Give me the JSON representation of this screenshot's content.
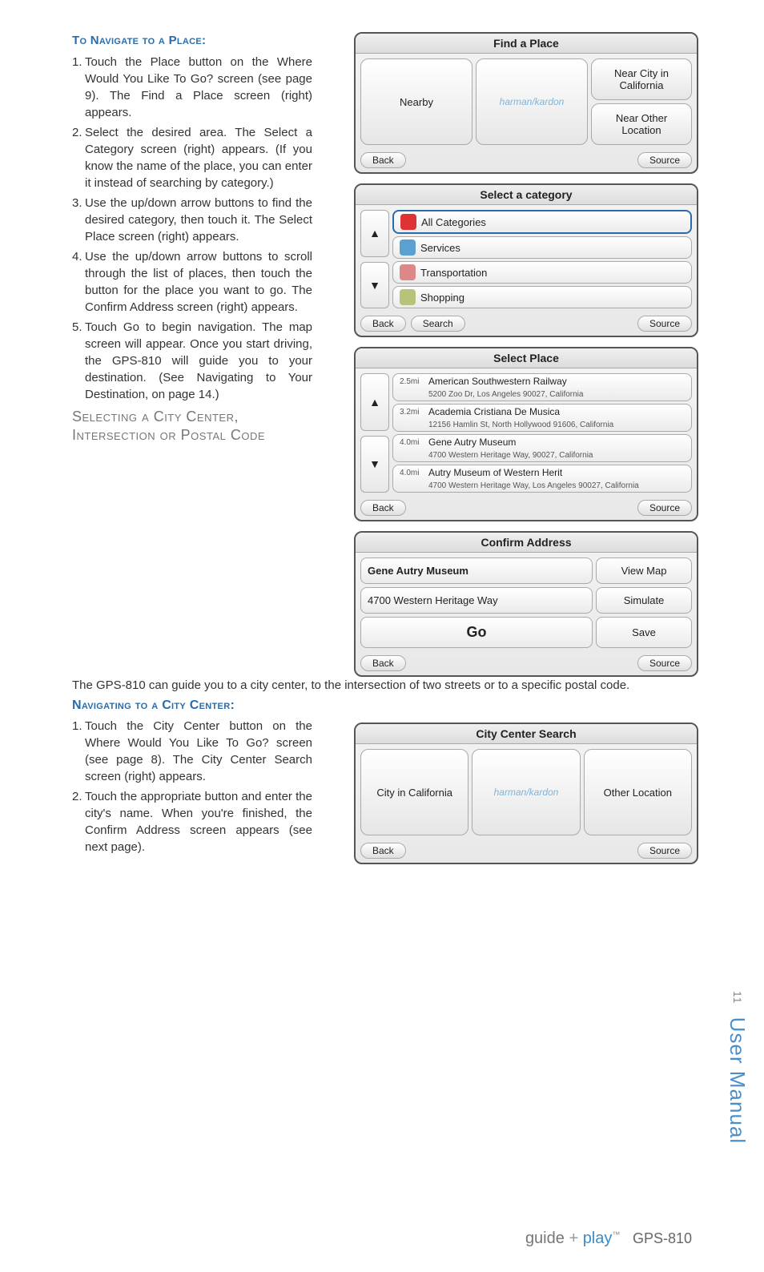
{
  "heading_navigate": "To Navigate to a Place:",
  "steps_navigate": [
    "Touch the Place button on the Where Would You Like To Go? screen (see page 9). The Find a Place screen (right) appears.",
    "Select the desired area. The Select a Category screen (right) appears. (If you know the name of the place, you can enter it instead of searching by category.)",
    "Use the up/down arrow buttons to find the desired category, then touch it. The Select Place screen (right) appears.",
    "Use the up/down arrow buttons to scroll through the list of places, then touch the button for the place you want to go. The Confirm Address screen (right) appears.",
    "Touch Go to begin navigation. The map screen will appear. Once you start driving, the GPS-810 will guide you to your destination. (See Navigating to Your Destination, on page 14.)"
  ],
  "subhead": "Selecting a City Center, Intersection or Postal Code",
  "sub_body": "The GPS-810 can guide you to a city center, to the intersection of two streets or to a specific postal code.",
  "heading_citycenter": "Navigating to a City Center:",
  "steps_citycenter": [
    "Touch the City Center button on the Where Would You Like To Go? screen (see page 8). The City Center Search screen (right) appears.",
    "Touch the appropriate button and enter the city's name. When you're finished, the Confirm Address screen appears (see next page)."
  ],
  "screens": {
    "find_place": {
      "title": "Find a Place",
      "left": "Nearby",
      "center": "harman/kardon",
      "right_top": "Near City in California",
      "right_bottom": "Near Other Location",
      "back": "Back",
      "source": "Source"
    },
    "select_category": {
      "title": "Select a category",
      "items": [
        {
          "label": "All Categories",
          "color": "#d33",
          "selected": true
        },
        {
          "label": "Services",
          "color": "#5aa0d0",
          "selected": false
        },
        {
          "label": "Transportation",
          "color": "#d88",
          "selected": false
        },
        {
          "label": "Shopping",
          "color": "#b9c27a",
          "selected": false
        }
      ],
      "back": "Back",
      "search": "Search",
      "source": "Source"
    },
    "select_place": {
      "title": "Select Place",
      "items": [
        {
          "dist": "2.5mi",
          "name": "American Southwestern Railway",
          "addr": "5200 Zoo Dr, Los Angeles 90027, California"
        },
        {
          "dist": "3.2mi",
          "name": "Academia Cristiana De Musica",
          "addr": "12156 Hamlin St, North Hollywood 91606, California"
        },
        {
          "dist": "4.0mi",
          "name": "Gene Autry Museum",
          "addr": "4700 Western Heritage Way, 90027, California"
        },
        {
          "dist": "4.0mi",
          "name": "Autry Museum of Western Herit",
          "addr": "4700 Western Heritage Way, Los Angeles 90027, California"
        }
      ],
      "back": "Back",
      "source": "Source"
    },
    "confirm": {
      "title": "Confirm Address",
      "name": "Gene Autry Museum",
      "addr": "4700 Western Heritage Way",
      "viewmap": "View Map",
      "simulate": "Simulate",
      "go": "Go",
      "save": "Save",
      "back": "Back",
      "source": "Source"
    },
    "city_center": {
      "title": "City Center Search",
      "left": "City in California",
      "center": "harman/kardon",
      "right": "Other Location",
      "back": "Back",
      "source": "Source"
    }
  },
  "side_tab": {
    "page": "11",
    "label": "User Manual"
  },
  "footer": {
    "guide": "guide",
    "plus": "+",
    "play": "play",
    "tm": "™",
    "model": "GPS-810"
  }
}
